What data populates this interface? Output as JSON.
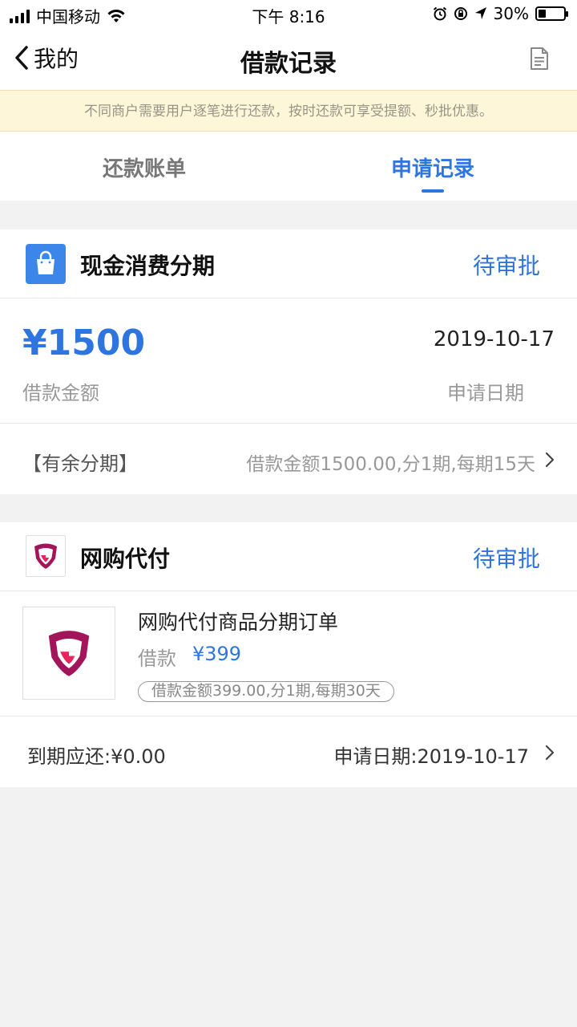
{
  "status_bar": {
    "carrier": "中国移动",
    "time": "下午 8:16",
    "battery": "30%",
    "battery_level": 0.3
  },
  "nav": {
    "back_label": "我的",
    "title": "借款记录"
  },
  "notice": "不同商户需要用户逐笔进行还款，按时还款可享受提额、秒批优惠。",
  "tabs": [
    {
      "label": "还款账单",
      "active": false
    },
    {
      "label": "申请记录",
      "active": true
    }
  ],
  "records": [
    {
      "title": "现金消费分期",
      "status": "待审批",
      "amount": "¥1500",
      "date": "2019-10-17",
      "amount_label": "借款金额",
      "date_label": "申请日期",
      "plan_name": "【有余分期】",
      "plan_detail": "借款金额1500.00,分1期,每期15天"
    },
    {
      "title": "网购代付",
      "status": "待审批",
      "product_title": "网购代付商品分期订单",
      "loan_label": "借款",
      "loan_value": "¥399",
      "plan_badge": "借款金额399.00,分1期,每期30天",
      "due_text": "到期应还:¥0.00",
      "apply_date": "申请日期:2019-10-17"
    }
  ],
  "colors": {
    "accent": "#2f75e0",
    "notice_bg": "#fdf6d9",
    "brand": "#d81b60"
  }
}
